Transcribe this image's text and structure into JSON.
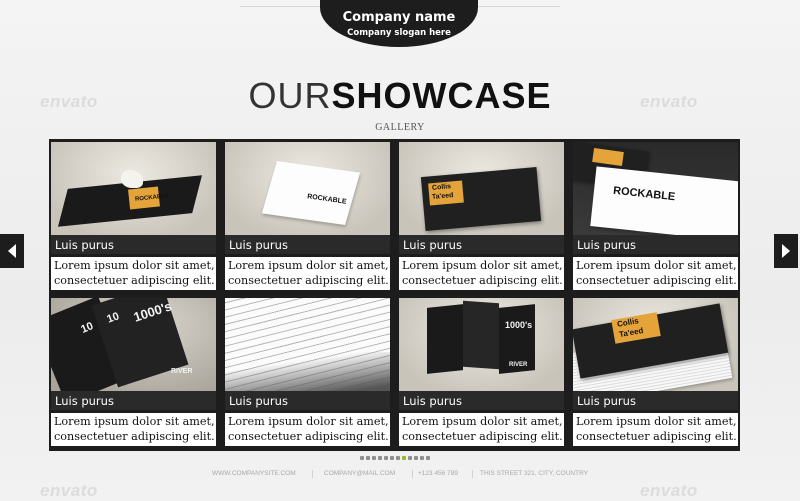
{
  "header": {
    "company_name": "Company name",
    "company_slogan": "Company slogan here"
  },
  "watermark": "envato",
  "title": {
    "light": "OUR",
    "bold": "SHOWCASE"
  },
  "subtitle": "GALLERY",
  "items": [
    {
      "caption": "Luis purus",
      "desc_line1": "Lorem ipsum dolor sit amet,",
      "desc_line2": "consectetuer adipiscing elit.",
      "thumb": "rockable-book"
    },
    {
      "caption": "Luis purus",
      "desc_line1": "Lorem ipsum dolor sit amet,",
      "desc_line2": "consectetuer adipiscing elit.",
      "thumb": "rockable-card"
    },
    {
      "caption": "Luis purus",
      "desc_line1": "Lorem ipsum dolor sit amet,",
      "desc_line2": "consectetuer adipiscing elit.",
      "thumb": "collis-card"
    },
    {
      "caption": "Luis purus",
      "desc_line1": "Lorem ipsum dolor sit amet,",
      "desc_line2": "consectetuer adipiscing elit.",
      "thumb": "rockable-cards-stack"
    },
    {
      "caption": "Luis purus",
      "desc_line1": "Lorem ipsum dolor sit amet,",
      "desc_line2": "consectetuer adipiscing elit.",
      "thumb": "1000s-brochure"
    },
    {
      "caption": "Luis purus",
      "desc_line1": "Lorem ipsum dolor sit amet,",
      "desc_line2": "consectetuer adipiscing elit.",
      "thumb": "open-book"
    },
    {
      "caption": "Luis purus",
      "desc_line1": "Lorem ipsum dolor sit amet,",
      "desc_line2": "consectetuer adipiscing elit.",
      "thumb": "trifold-brochure"
    },
    {
      "caption": "Luis purus",
      "desc_line1": "Lorem ipsum dolor sit amet,",
      "desc_line2": "consectetuer adipiscing elit.",
      "thumb": "collis-cards-stack"
    }
  ],
  "thumb_text": {
    "rockable": "ROCKABLE",
    "collis": "Collis",
    "taeed": "Ta'eed",
    "n1000s": "1000's",
    "n10": "10",
    "river": "RIVER"
  },
  "pager": {
    "count": 12,
    "active_index": 7,
    "active_color": "#8fbf2a"
  },
  "footer": {
    "website": "WWW.COMPANYSITE.COM",
    "email": "COMPANY@MAIL.COM",
    "phone": "+123 456 789",
    "address": "THIS STREET 321, CITY, COUNTRY"
  },
  "colors": {
    "panel": "#1d1d1d",
    "accent": "#e5a43a"
  }
}
